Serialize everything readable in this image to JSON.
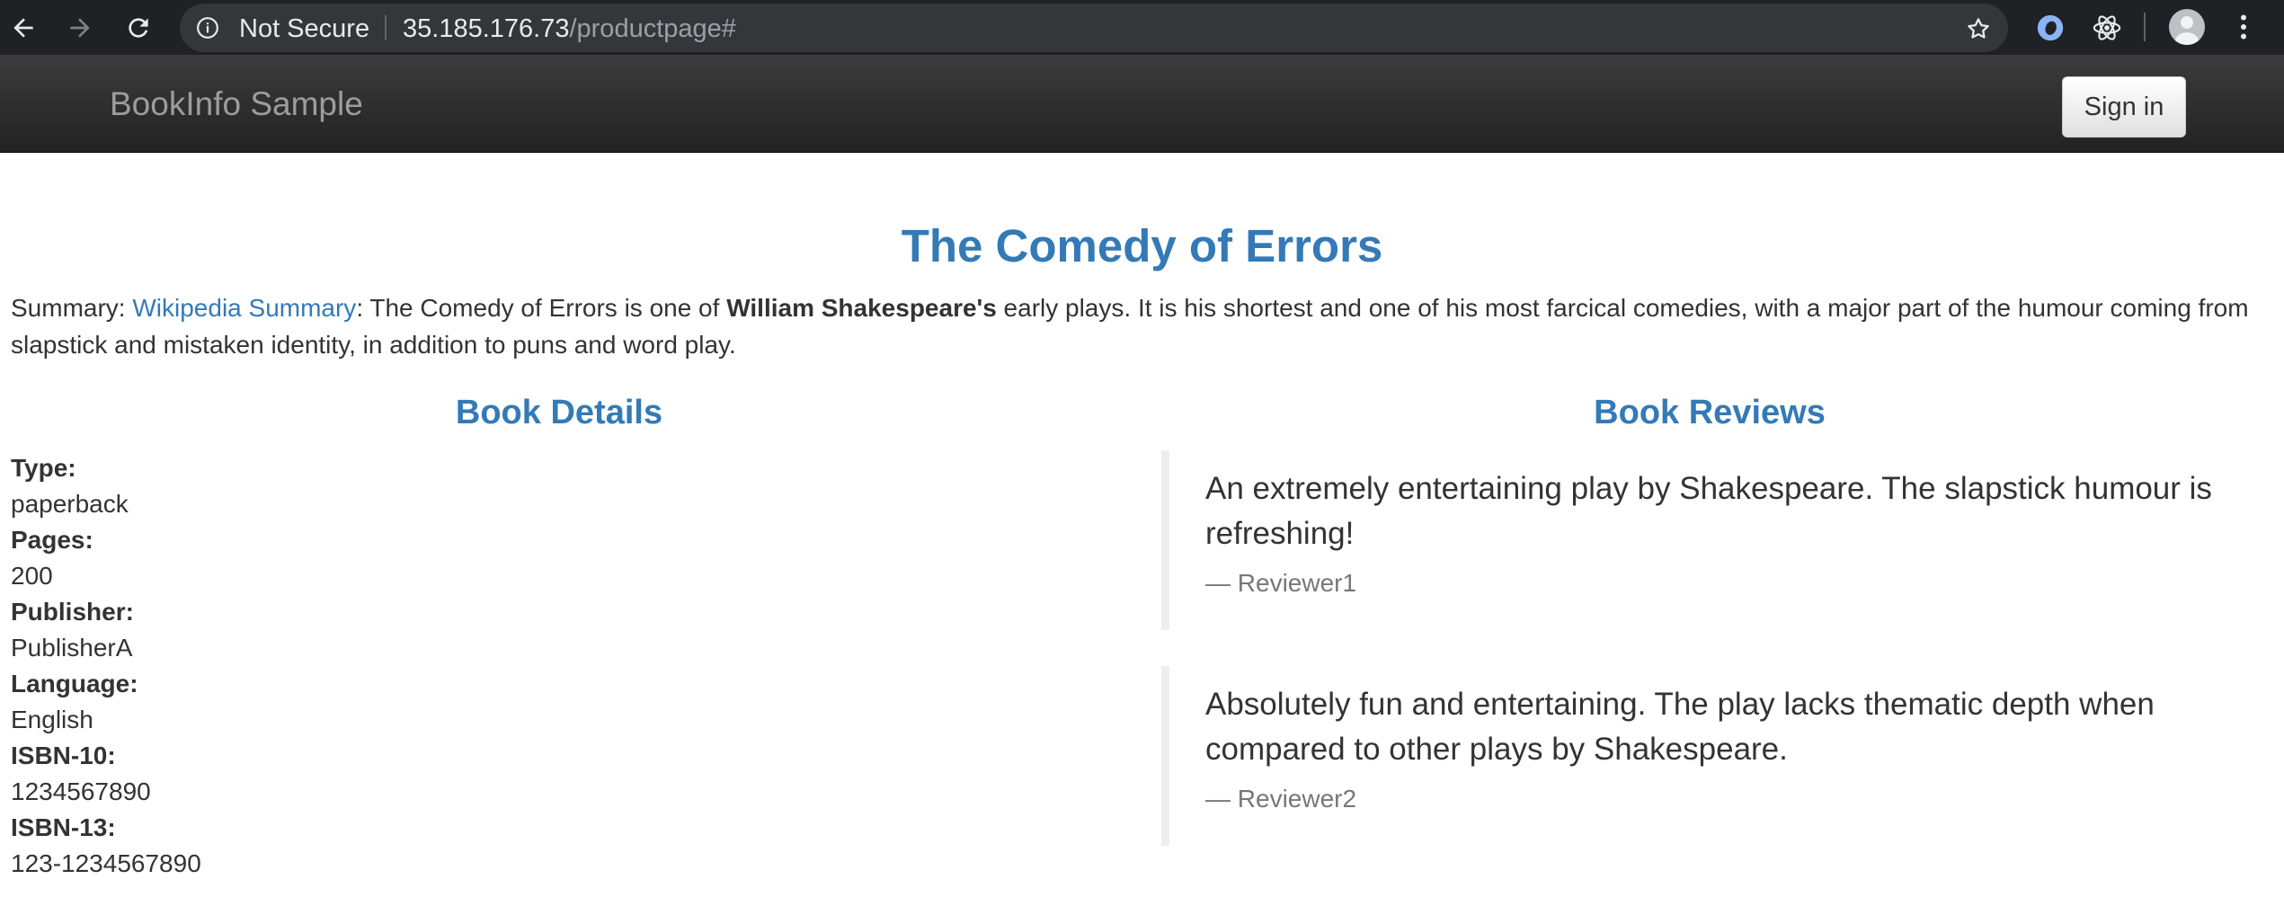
{
  "browser": {
    "security_label": "Not Secure",
    "url_host": "35.185.176.73",
    "url_path": "/productpage#"
  },
  "navbar": {
    "brand": "BookInfo Sample",
    "signin_label": "Sign in"
  },
  "book": {
    "title": "The Comedy of Errors",
    "summary_prefix": "Summary: ",
    "summary_link": "Wikipedia Summary",
    "summary_part1": ": The Comedy of Errors is one of ",
    "summary_bold": "William Shakespeare's",
    "summary_part2": " early plays. It is his shortest and one of his most farcical comedies, with a major part of the humour coming from slapstick and mistaken identity, in addition to puns and word play."
  },
  "details": {
    "heading": "Book Details",
    "fields": [
      {
        "label": "Type:",
        "value": "paperback"
      },
      {
        "label": "Pages:",
        "value": "200"
      },
      {
        "label": "Publisher:",
        "value": "PublisherA"
      },
      {
        "label": "Language:",
        "value": "English"
      },
      {
        "label": "ISBN-10:",
        "value": "1234567890"
      },
      {
        "label": "ISBN-13:",
        "value": "123-1234567890"
      }
    ]
  },
  "reviews": {
    "heading": "Book Reviews",
    "items": [
      {
        "text": "An extremely entertaining play by Shakespeare. The slapstick humour is refreshing!",
        "reviewer": "— Reviewer1"
      },
      {
        "text": "Absolutely fun and entertaining. The play lacks thematic depth when compared to other plays by Shakespeare.",
        "reviewer": "— Reviewer2"
      }
    ]
  }
}
